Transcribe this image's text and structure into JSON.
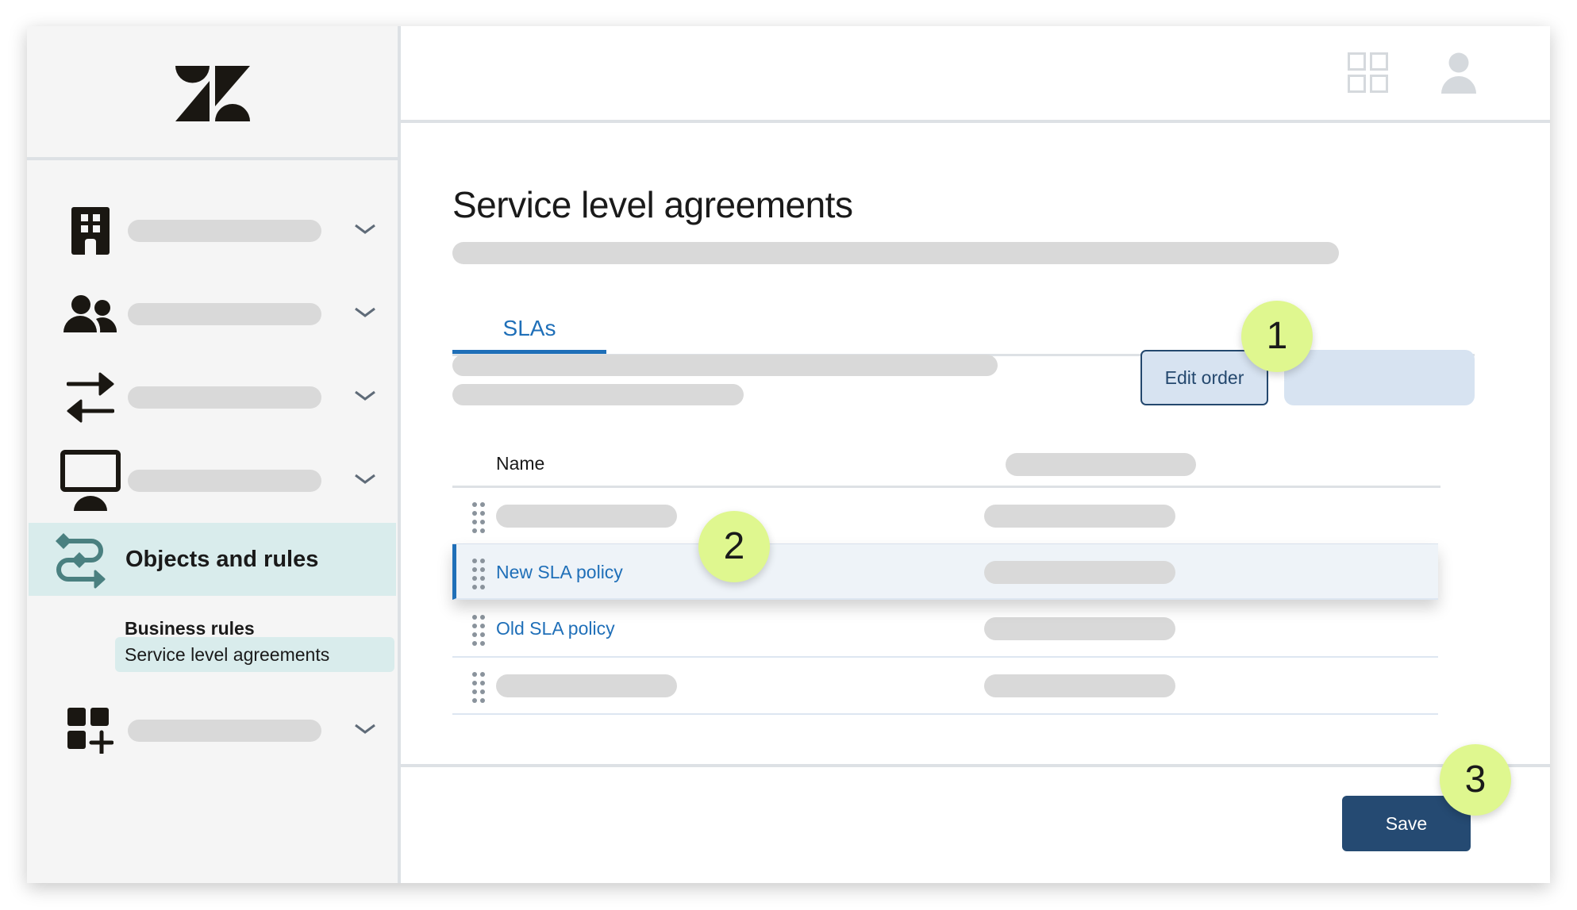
{
  "sidebar": {
    "logo": "zendesk-logo",
    "nav_items": [
      {
        "icon": "building-icon",
        "label": ""
      },
      {
        "icon": "users-icon",
        "label": ""
      },
      {
        "icon": "arrows-swap-icon",
        "label": ""
      },
      {
        "icon": "monitor-icon",
        "label": ""
      }
    ],
    "active_item": {
      "icon": "workflow-icon",
      "label": "Objects and rules"
    },
    "sub_items": [
      {
        "label": "Business rules",
        "selected": false
      },
      {
        "label": "Service level agreements",
        "selected": true
      }
    ],
    "bottom_item": {
      "icon": "add-apps-icon",
      "label": ""
    }
  },
  "header": {
    "icons": [
      "apps-grid-icon",
      "user-avatar-icon"
    ]
  },
  "main": {
    "title": "Service level agreements",
    "tabs": [
      {
        "label": "SLAs",
        "active": true
      }
    ],
    "buttons": {
      "edit_order": "Edit order",
      "save": "Save"
    },
    "table": {
      "columns": [
        "Name",
        ""
      ],
      "rows": [
        {
          "name": "",
          "dragging": false
        },
        {
          "name": "New SLA policy",
          "dragging": true
        },
        {
          "name": "Old SLA policy",
          "dragging": false
        },
        {
          "name": "",
          "dragging": false
        }
      ]
    }
  },
  "annotations": [
    {
      "number": "1",
      "target": "edit-order-button"
    },
    {
      "number": "2",
      "target": "new-sla-policy-row"
    },
    {
      "number": "3",
      "target": "save-button"
    }
  ],
  "colors": {
    "accent_blue": "#1f6fb8",
    "save_button": "#254a72",
    "sidebar_highlight": "#d9ecec",
    "annotation_badge": "#dff78f",
    "workflow_icon": "#4a8080"
  }
}
